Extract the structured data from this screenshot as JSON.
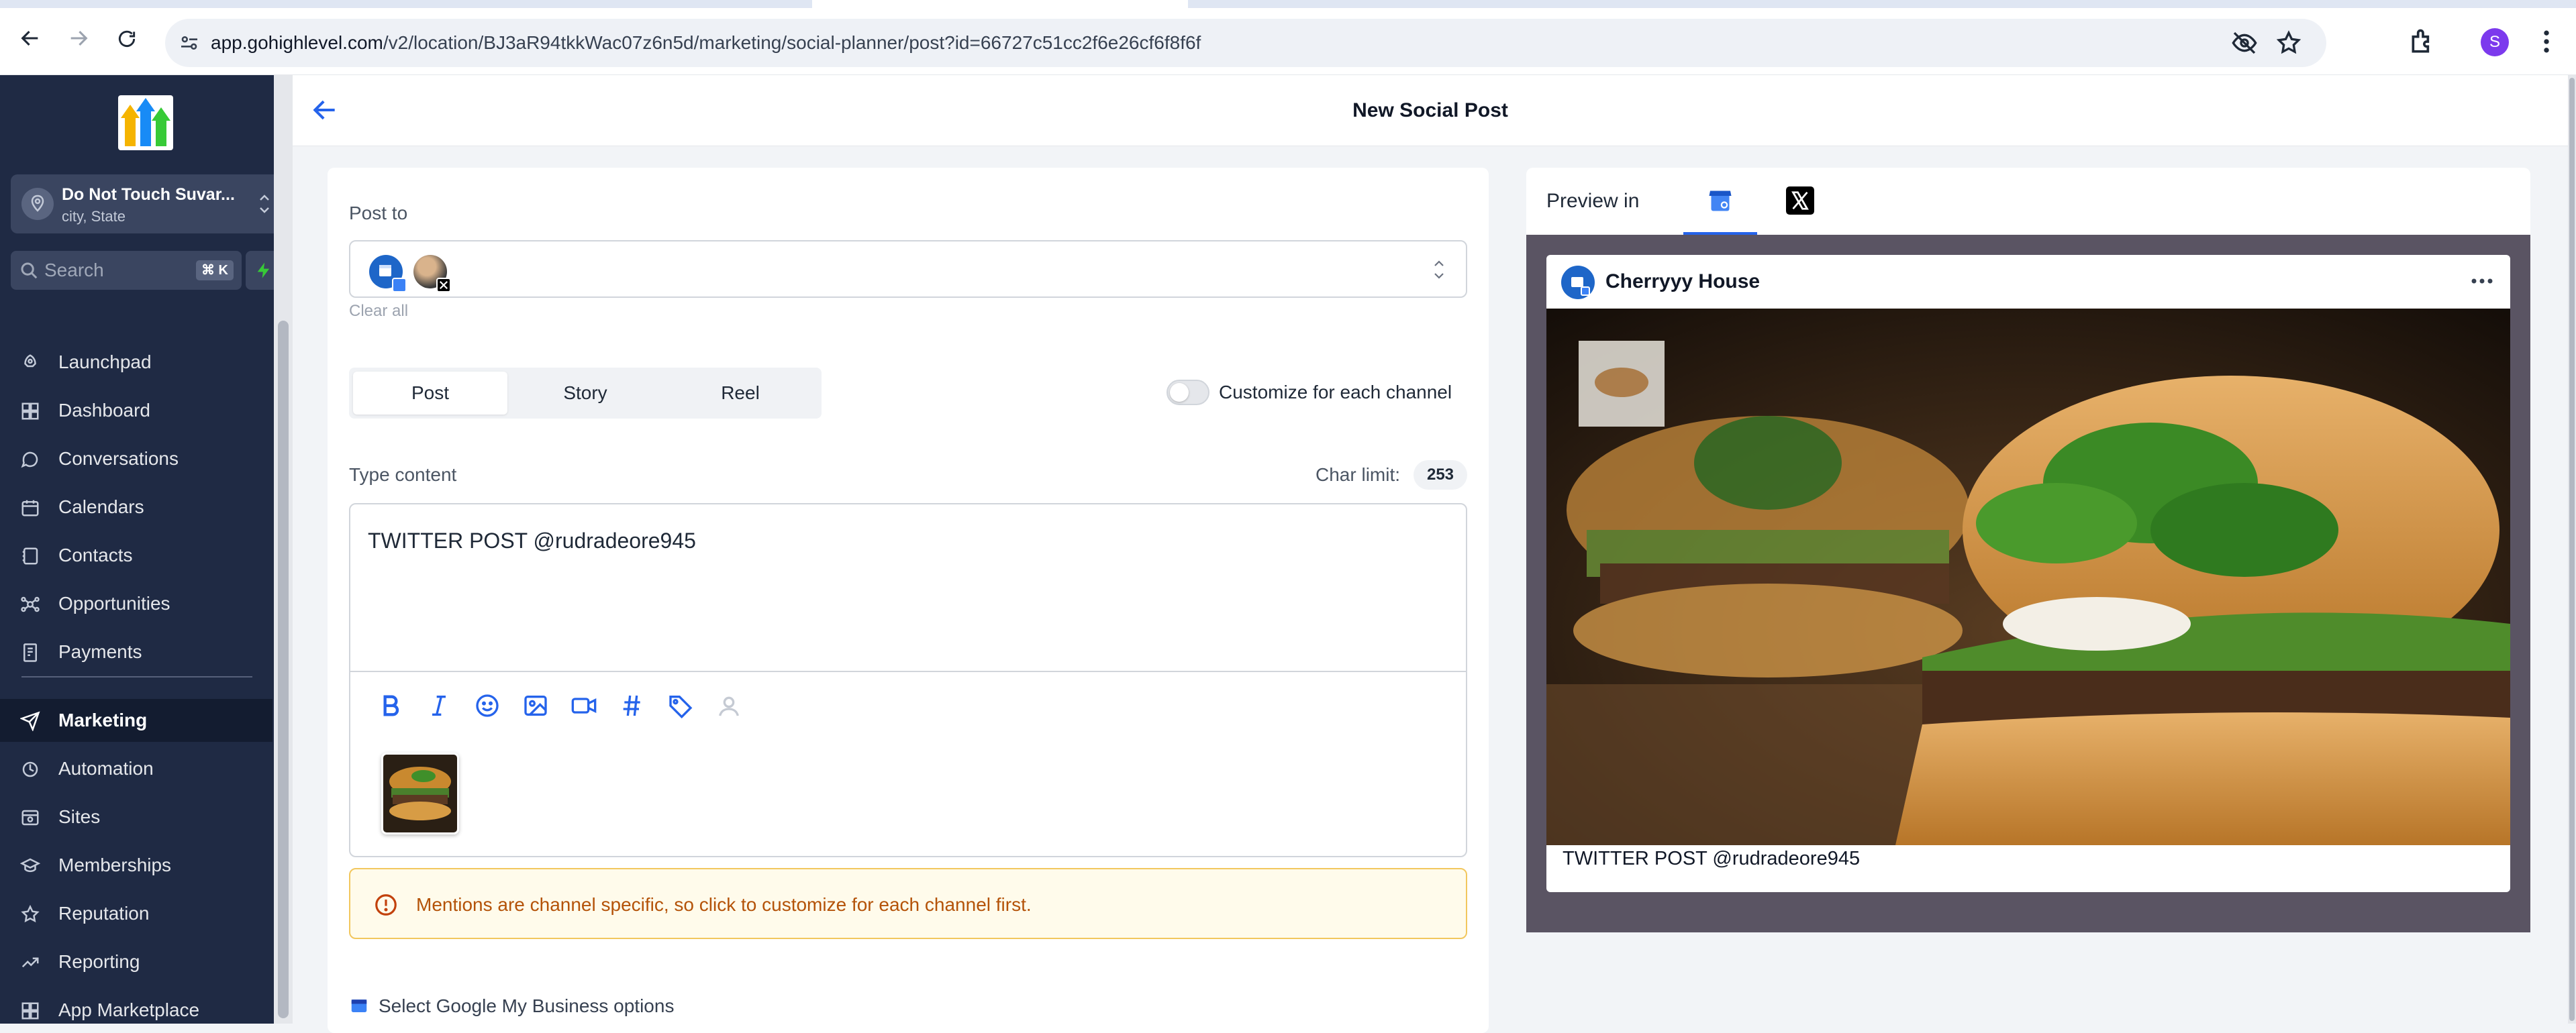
{
  "browser": {
    "url_domain": "app.gohighlevel.com",
    "url_path": "/v2/location/BJ3aR94tkkWac07z6n5d/marketing/social-planner/post?id=66727c51cc2f6e26cf6f8f6f",
    "profile_initial": "S"
  },
  "sidebar": {
    "location_name": "Do Not Touch Suvar...",
    "location_sub": "city, State",
    "search_placeholder": "Search",
    "search_shortcut": "⌘ K",
    "items": [
      {
        "label": "Launchpad",
        "icon": "rocket-icon"
      },
      {
        "label": "Dashboard",
        "icon": "dashboard-icon"
      },
      {
        "label": "Conversations",
        "icon": "chat-icon"
      },
      {
        "label": "Calendars",
        "icon": "calendar-icon"
      },
      {
        "label": "Contacts",
        "icon": "contacts-icon"
      },
      {
        "label": "Opportunities",
        "icon": "opportunities-icon"
      },
      {
        "label": "Payments",
        "icon": "payments-icon"
      },
      {
        "label": "Marketing",
        "icon": "send-icon",
        "active": true
      },
      {
        "label": "Automation",
        "icon": "automation-icon"
      },
      {
        "label": "Sites",
        "icon": "sites-icon"
      },
      {
        "label": "Memberships",
        "icon": "memberships-icon"
      },
      {
        "label": "Reputation",
        "icon": "star-icon"
      },
      {
        "label": "Reporting",
        "icon": "reporting-icon"
      },
      {
        "label": "App Marketplace",
        "icon": "apps-icon"
      }
    ]
  },
  "header": {
    "title": "New Social Post"
  },
  "composer": {
    "post_to_label": "Post to",
    "clear_all": "Clear all",
    "tabs": [
      "Post",
      "Story",
      "Reel"
    ],
    "active_tab": "Post",
    "customize_label": "Customize for each channel",
    "customize_enabled": false,
    "type_content_label": "Type content",
    "char_limit_label": "Char limit:",
    "char_limit_value": "253",
    "content": "TWITTER POST @rudradeore945",
    "alert_text": "Mentions are channel specific, so click to customize for each channel first.",
    "gmb_options_label": "Select Google My Business options"
  },
  "preview": {
    "label": "Preview in",
    "tabs": [
      "google-business-icon",
      "x-twitter-icon"
    ],
    "active_tab": "google-business-icon",
    "account_name": "Cherryyy House",
    "caption": "TWITTER POST @rudradeore945"
  },
  "colors": {
    "sidebar_bg": "#1f2a44",
    "accent": "#2563eb",
    "alert_border": "#f2c75e",
    "alert_text": "#b45309"
  }
}
